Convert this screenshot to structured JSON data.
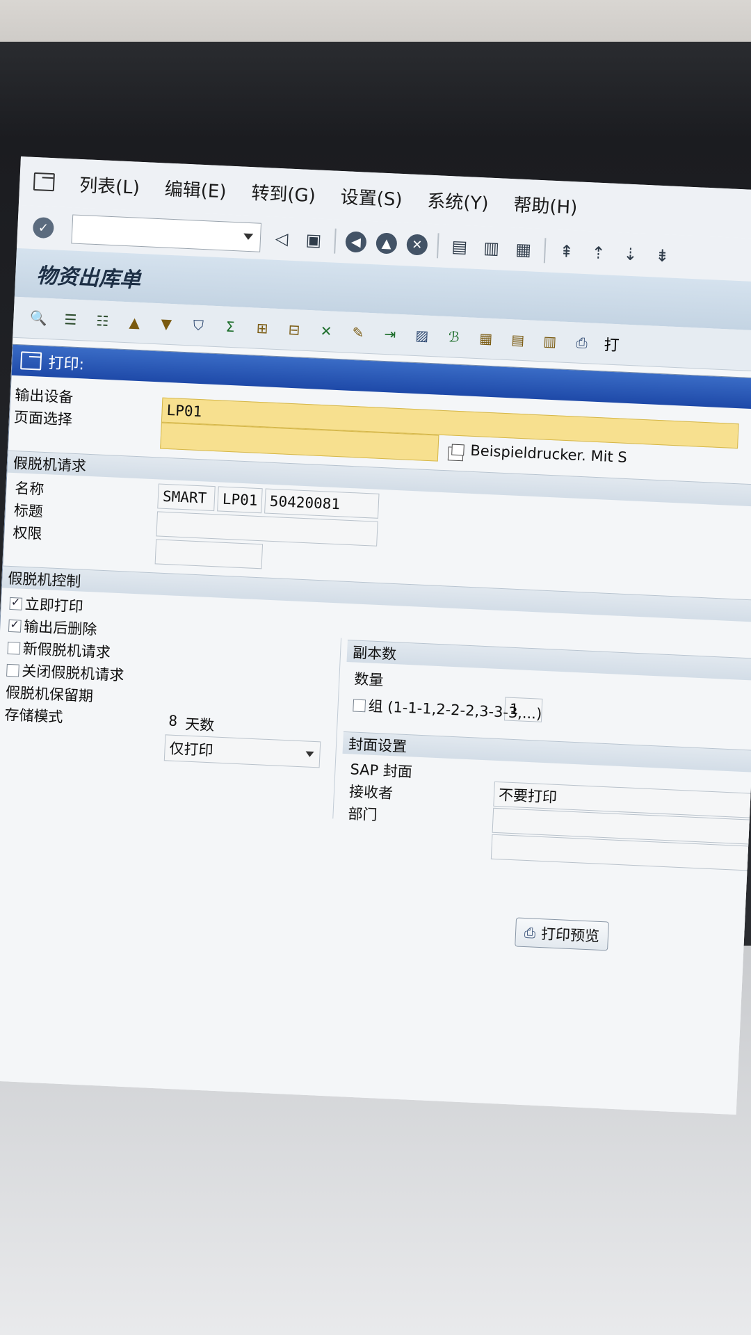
{
  "menu": {
    "items": [
      "列表(L)",
      "编辑(E)",
      "转到(G)",
      "设置(S)",
      "系统(Y)",
      "帮助(H)"
    ]
  },
  "page_title": "物资出库单",
  "dialog": {
    "title": "打印:",
    "output_device_label": "输出设备",
    "page_select_label": "页面选择",
    "output_device_value": "LP01",
    "printer_desc": "Beispieldrucker. Mit S",
    "spool_request": {
      "header": "假脱机请求",
      "name_label": "名称",
      "title_label": "标题",
      "auth_label": "权限",
      "name_part1": "SMART",
      "name_part2": "LP01",
      "name_part3": "50420081"
    },
    "spool_control": {
      "header": "假脱机控制",
      "print_now": "立即打印",
      "print_now_checked": true,
      "delete_after": "输出后删除",
      "delete_after_checked": true,
      "new_request": "新假脱机请求",
      "new_request_checked": false,
      "close_request": "关闭假脱机请求",
      "close_request_checked": false,
      "retention_label": "假脱机保留期",
      "storage_label": "存储模式",
      "retention_value": "8",
      "retention_unit": "天数",
      "storage_value": "仅打印"
    },
    "copies": {
      "header": "副本数",
      "quantity_label": "数量",
      "quantity_value": "1",
      "group_label": "组 (1-1-1,2-2-2,3-3-3,...)",
      "group_checked": false
    },
    "cover": {
      "header": "封面设置",
      "sap_cover_label": "SAP 封面",
      "sap_cover_value": "不要打印",
      "recipient_label": "接收者",
      "department_label": "部门"
    },
    "print_preview_button": "打印预览"
  },
  "toolbar_right_label": "打"
}
